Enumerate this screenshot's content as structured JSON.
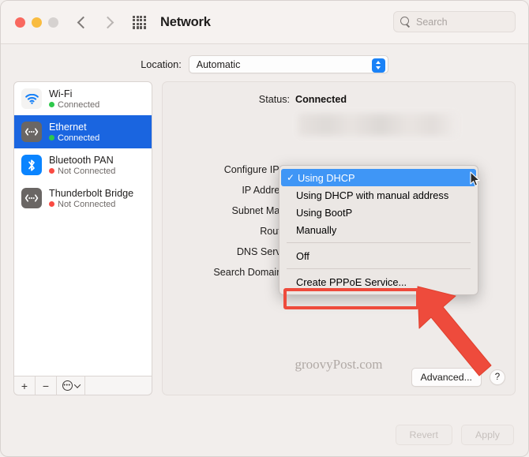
{
  "window": {
    "title": "Network",
    "traffic_lights": [
      "close",
      "minimize",
      "zoom"
    ],
    "nav_back_icon": "chevron-left-icon",
    "nav_forward_icon": "chevron-right-icon",
    "grid_icon": "grid-apps-icon"
  },
  "search": {
    "placeholder": "Search",
    "icon": "search-icon"
  },
  "location": {
    "label": "Location:",
    "value": "Automatic",
    "options": [
      "Automatic"
    ],
    "stepper_icon": "chevron-updown-icon"
  },
  "sidebar": {
    "items": [
      {
        "name": "Wi-Fi",
        "status": "Connected",
        "connected": true,
        "icon": "wifi-icon",
        "selected": false
      },
      {
        "name": "Ethernet",
        "status": "Connected",
        "connected": true,
        "icon": "ethernet-icon",
        "selected": true
      },
      {
        "name": "Bluetooth PAN",
        "status": "Not Connected",
        "connected": false,
        "icon": "bluetooth-icon",
        "selected": false
      },
      {
        "name": "Thunderbolt Bridge",
        "status": "Not Connected",
        "connected": false,
        "icon": "ethernet-icon",
        "selected": false
      }
    ],
    "toolbar": {
      "add_label": "+",
      "remove_label": "−",
      "actions_icon": "gear-icon",
      "actions_chevron": "chevron-down-icon"
    }
  },
  "main": {
    "status_label": "Status:",
    "status_value": "Connected",
    "fields": [
      {
        "label": "Configure IPv4",
        "value": ""
      },
      {
        "label": "IP Address",
        "value": ""
      },
      {
        "label": "Subnet Mask",
        "value": ""
      },
      {
        "label": "Router",
        "value": ""
      },
      {
        "label": "DNS Server",
        "value": ""
      },
      {
        "label": "Search Domains:",
        "value": ""
      }
    ],
    "advanced_label": "Advanced...",
    "help_label": "?",
    "watermark": "groovyPost.com"
  },
  "footer": {
    "revert_label": "Revert",
    "apply_label": "Apply"
  },
  "dropdown": {
    "items": [
      {
        "label": "Using DHCP",
        "checked": true,
        "selected": true
      },
      {
        "label": "Using DHCP with manual address",
        "checked": false,
        "selected": false
      },
      {
        "label": "Using BootP",
        "checked": false,
        "selected": false
      },
      {
        "label": "Manually",
        "checked": false,
        "selected": false
      },
      {
        "label": "Off",
        "checked": false,
        "selected": false
      },
      {
        "label": "Create PPPoE Service...",
        "checked": false,
        "selected": false
      }
    ],
    "check_glyph": "✓",
    "highlighted_item": "Create PPPoE Service..."
  },
  "annotation": {
    "color": "#ee4b3c",
    "arrow_icon": "arrow-pointer-icon",
    "highlight_target": "Create PPPoE Service..."
  },
  "colors": {
    "accent_blue": "#1a65e0",
    "menu_highlight": "#3f96f6",
    "connected_green": "#2ec84b",
    "disconnected_red": "#fa4a42",
    "annotation_red": "#ee4b3c"
  }
}
